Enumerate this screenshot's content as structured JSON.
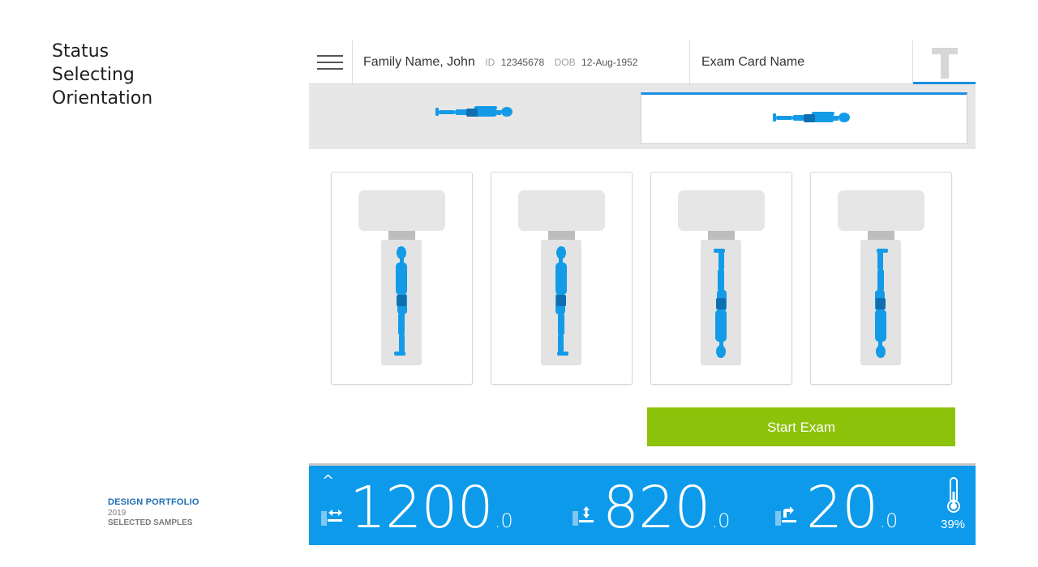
{
  "status": {
    "line1": "Status",
    "line2": "Selecting",
    "line3": "Orientation"
  },
  "portfolio": {
    "title": "DESIGN PORTFOLIO",
    "year": "2019",
    "subtitle": "SELECTED SAMPLES"
  },
  "header": {
    "patient_name": "Family Name, John",
    "id_label": "ID",
    "id_value": "12345678",
    "dob_label": "DOB",
    "dob_value": "12-Aug-1952",
    "exam_card": "Exam Card Name"
  },
  "orientation_tabs": [
    {
      "icon": "supine-feet-first-icon",
      "selected": false
    },
    {
      "icon": "supine-head-first-icon",
      "selected": true
    }
  ],
  "position_cards": [
    {
      "icon": "standing-facing-left-icon"
    },
    {
      "icon": "standing-facing-right-icon"
    },
    {
      "icon": "inverted-facing-left-icon"
    },
    {
      "icon": "inverted-facing-right-icon"
    }
  ],
  "start_button": "Start Exam",
  "footer": {
    "horizontal": {
      "value": "1200",
      "decimal": ".0"
    },
    "vertical": {
      "value": "820",
      "decimal": ".0"
    },
    "angle": {
      "value": "20",
      "decimal": ".0"
    },
    "temperature": "39%"
  },
  "colors": {
    "accent": "#1a8fe3",
    "body_blue": "#149be8",
    "start_green": "#8cc20a",
    "footer_blue": "#0d9aea"
  }
}
